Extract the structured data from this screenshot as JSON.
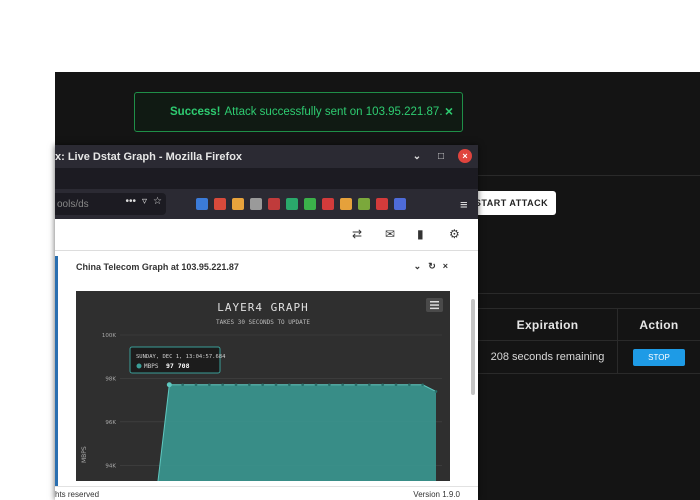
{
  "toast": {
    "strong": "Success!",
    "message": "Attack successfully sent on 103.95.221.87.",
    "close": "×"
  },
  "start_button": "START ATTACK",
  "table": {
    "headers": [
      "Expiration",
      "Action"
    ],
    "rows": [
      {
        "expiration": "208 seconds remaining",
        "action": "STOP"
      }
    ]
  },
  "firefox": {
    "title": "x: Live Dstat Graph - Mozilla Firefox",
    "url": "ools/ds",
    "controls": {
      "minimize": "⌄",
      "maximize": "□",
      "close": "×"
    },
    "extension_colors": [
      "#3b7bd8",
      "#d84a3b",
      "#e8a33c",
      "#9a9a9a",
      "#c03b3b",
      "#2aa86b",
      "#3bb04a",
      "#d23b3b",
      "#e6a13b",
      "#7ba83b",
      "#d33b3b",
      "#4e6bd8"
    ]
  },
  "panel": {
    "title": "China Telecom Graph at 103.95.221.87",
    "controls": [
      "⌄",
      "↻",
      "×"
    ]
  },
  "chart_data": {
    "type": "area",
    "title": "LAYER4 GRAPH",
    "subtitle": "TAKES 30 SECONDS TO UPDATE",
    "ylabel": "MBPS",
    "y_ticks": [
      "100K",
      "98K",
      "96K",
      "94K"
    ],
    "ylim": [
      93000,
      100000
    ],
    "x": [
      0,
      1,
      2,
      3,
      4,
      5,
      6,
      7,
      8,
      9,
      10,
      11,
      12,
      13,
      14,
      15,
      16,
      17,
      18,
      19,
      20,
      21
    ],
    "series": [
      {
        "name": "MBPS",
        "values": [
          92500,
          97708,
          97708,
          97708,
          97708,
          97708,
          97708,
          97708,
          97708,
          97708,
          97708,
          97708,
          97708,
          97708,
          97708,
          97708,
          97708,
          97708,
          97708,
          97708,
          97708,
          97400
        ]
      }
    ],
    "tooltip": {
      "date": "SUNDAY, DEC 1, 13:04:57.684",
      "label": "MBPS",
      "value": "97 708"
    },
    "color": "#3a9e97"
  },
  "footer": {
    "left": "hts reserved",
    "right": "Version 1.9.0"
  }
}
